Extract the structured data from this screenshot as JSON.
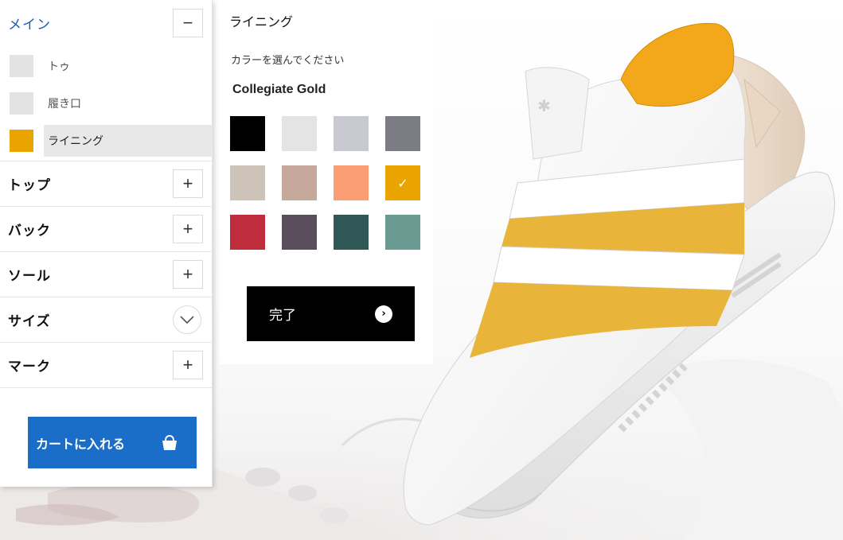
{
  "left_panel": {
    "main_section": {
      "title": "メイン",
      "toggle": "−"
    },
    "sub_items": [
      {
        "label": "トゥ",
        "color": "#e3e3e3"
      },
      {
        "label": "履き口",
        "color": "#e3e3e3"
      },
      {
        "label": "ライニング",
        "color": "#eaa400",
        "active": true
      }
    ],
    "sections": [
      {
        "title": "トップ",
        "toggle": "+"
      },
      {
        "title": "バック",
        "toggle": "+"
      },
      {
        "title": "ソール",
        "toggle": "+"
      },
      {
        "title": "サイズ",
        "toggle": "chevron-down-icon"
      },
      {
        "title": "マーク",
        "toggle": "+"
      }
    ],
    "cart_button": {
      "label": "カートに入れる",
      "icon": "shopping-bag-icon",
      "color": "#1b6ec8"
    }
  },
  "color_panel": {
    "title": "ライニング",
    "prompt": "カラーを選んでください",
    "selected_color_name": "Collegiate Gold",
    "swatches": [
      {
        "color": "#000000"
      },
      {
        "color": "#e4e4e4"
      },
      {
        "color": "#c8c9d1"
      },
      {
        "color": "#7c7c84"
      },
      {
        "color": "#cdc3b8"
      },
      {
        "color": "#c6a99b"
      },
      {
        "color": "#fb9e76"
      },
      {
        "color": "#eaa400",
        "selected": true
      },
      {
        "color": "#bf2d3c"
      },
      {
        "color": "#5a4d5c"
      },
      {
        "color": "#2e5755"
      },
      {
        "color": "#6b9a92"
      }
    ],
    "done_button": {
      "label": "完了",
      "icon": "arrow-right-circle-icon"
    }
  },
  "colors": {
    "accent_blue": "#1a5fb4",
    "lining_gold": "#f3a81c",
    "band_gold": "#e9b43a"
  }
}
